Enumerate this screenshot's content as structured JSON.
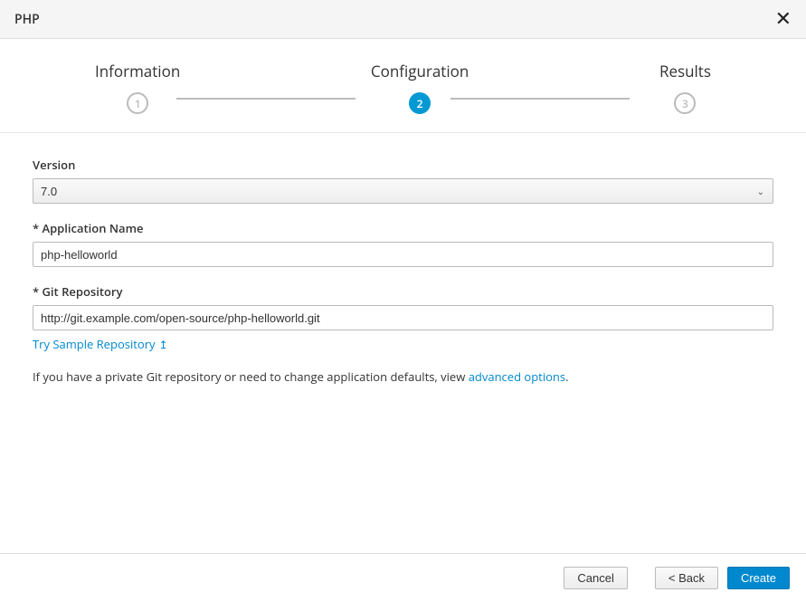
{
  "header": {
    "title": "PHP"
  },
  "steps": {
    "step1": {
      "label": "Information",
      "number": "1"
    },
    "step2": {
      "label": "Configuration",
      "number": "2"
    },
    "step3": {
      "label": "Results",
      "number": "3"
    }
  },
  "form": {
    "version": {
      "label": "Version",
      "value": "7.0"
    },
    "appName": {
      "label": "* Application Name",
      "value": "php-helloworld"
    },
    "gitRepo": {
      "label": "* Git Repository",
      "value": "http://git.example.com/open-source/php-helloworld.git"
    },
    "trySample": "Try Sample Repository",
    "helpTextPrefix": "If you have a private Git repository or need to change application defaults, view ",
    "helpTextLink": "advanced options",
    "helpTextSuffix": "."
  },
  "footer": {
    "cancel": "Cancel",
    "back": "< Back",
    "create": "Create"
  }
}
